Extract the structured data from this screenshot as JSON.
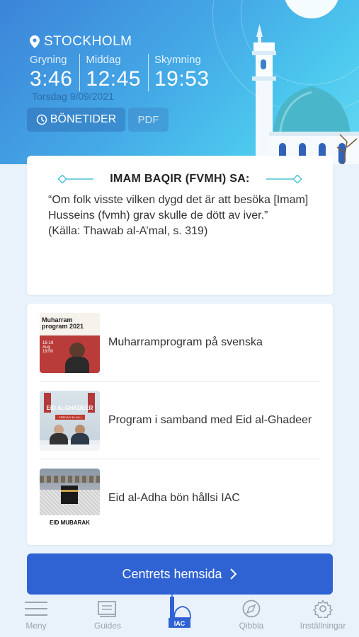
{
  "header": {
    "city": "STOCKHOLM",
    "prayers": [
      {
        "label": "Gryning",
        "time": "3:46"
      },
      {
        "label": "Middag",
        "time": "12:45"
      },
      {
        "label": "Skymning",
        "time": "19:53"
      }
    ],
    "date": "Torsdag  9/09/2021",
    "prayer_times_button": "BÖNETIDER",
    "pdf_button": "PDF"
  },
  "quote": {
    "title": "IMAM BAQIR (FVMH) SA:",
    "text": "“Om folk visste vilken dygd det är att besöka [Imam] Husseins (fvmh) grav skulle de dött av iver.”",
    "source": "(Källa: Thawab al-A’mal, s. 319)"
  },
  "programs": [
    {
      "title": "Muharramprogram på svenska",
      "thumb_title": "Muharram program 2021",
      "thumb_sub": "16-19 Aug 19:00"
    },
    {
      "title": "Program i samband med Eid al-Ghadeer",
      "thumb_title": "EID ALGHADEER",
      "thumb_sub": "FREDAG 30 JULI"
    },
    {
      "title": "Eid al-Adha bön hållsi IAC",
      "thumb_title": "EID MUBARAK"
    }
  ],
  "website_button": "Centrets hemsida",
  "nav": {
    "menu": "Meny",
    "guides": "Guides",
    "home_logo": "IAC",
    "qibla": "Qibbla",
    "settings": "Inställningar"
  },
  "colors": {
    "accent": "#2f62d3",
    "header_start": "#3c84d8",
    "header_end": "#66d9f2"
  }
}
